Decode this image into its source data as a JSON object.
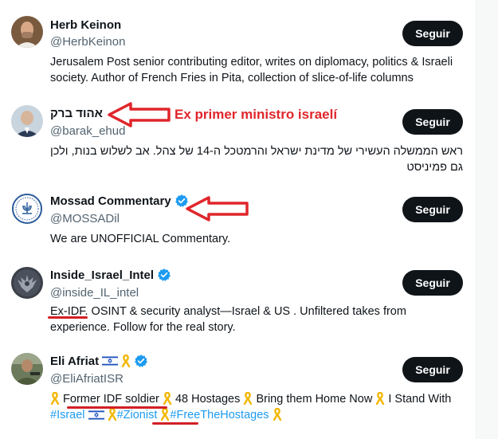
{
  "colors": {
    "accent": "#1d9bf0",
    "annotation": "#e0262b",
    "button_bg": "#0f1419"
  },
  "follow_label": "Seguir",
  "annotation": {
    "label": "Ex primer ministro israelí"
  },
  "accounts": [
    {
      "name": "Herb Keinon",
      "handle": "@HerbKeinon",
      "bio": "Jerusalem Post senior contributing editor, writes on diplomacy, politics & Israeli society. Author of French Fries in Pita, collection of slice-of-life columns",
      "avatar": "person-photo-avatar"
    },
    {
      "name": "אהוד ברק",
      "handle": "@barak_ehud",
      "bio": "ראש הממשלה העשירי של מדינת ישראל והרמטכל ה-14 של צהל. אב לשלוש בנות, ולכן גם פמיניסט",
      "avatar": "person-photo-avatar"
    },
    {
      "name": "Mossad Commentary",
      "handle": "@MOSSADil",
      "bio": "We are UNOFFICIAL Commentary.",
      "verified": true,
      "avatar": "mossad-emblem-avatar"
    },
    {
      "name": "Inside_Israel_Intel",
      "handle": "@inside_IL_intel",
      "bio_prefix": "Ex-IDF",
      "bio_rest": ". OSINT & security analyst—Israel & US . Unfiltered takes from experience. Follow for the real story.",
      "verified": true,
      "avatar": "eagle-emblem-avatar"
    },
    {
      "name": "Eli Afriat",
      "handle": "@EliAfriatISR",
      "verified": true,
      "avatar": "soldier-photo-avatar",
      "name_icons": [
        "israel-flag-icon",
        "yellow-ribbon-icon"
      ],
      "bio_parts": {
        "p1": "Former IDF soldier",
        "p2": "48 Hostages",
        "p3": "Bring them Home Now",
        "p4": "I Stand",
        "p5": "With",
        "tag1": "#Israel",
        "tag2": "#Zionist",
        "tag3": "#FreeTheHostages"
      }
    }
  ]
}
